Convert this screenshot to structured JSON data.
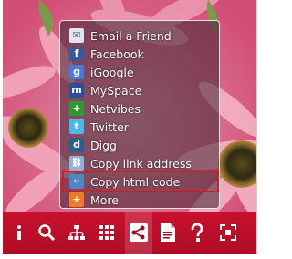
{
  "share_menu": {
    "items": [
      {
        "label": "Email a Friend",
        "icon": "email-icon",
        "icon_color": "#dfe6ee"
      },
      {
        "label": "Facebook",
        "icon": "facebook-icon",
        "icon_color": "#3b5998"
      },
      {
        "label": "iGoogle",
        "icon": "igoogle-icon",
        "icon_color": "#4a7bd9"
      },
      {
        "label": "MySpace",
        "icon": "myspace-icon",
        "icon_color": "#2b4f9b"
      },
      {
        "label": "Netvibes",
        "icon": "netvibes-icon",
        "icon_color": "#2f9a33"
      },
      {
        "label": "Twitter",
        "icon": "twitter-icon",
        "icon_color": "#4fb7e8"
      },
      {
        "label": "Digg",
        "icon": "digg-icon",
        "icon_color": "#2f5f8f"
      },
      {
        "label": "Copy link address",
        "icon": "link-icon",
        "icon_color": "#8fb3d9"
      },
      {
        "label": "Copy html code",
        "icon": "code-icon",
        "icon_color": "#4f86c6"
      },
      {
        "label": "More",
        "icon": "more-icon",
        "icon_color": "#f07a2a"
      }
    ],
    "highlighted_item": "Copy html code",
    "highlight_color": "#e0141c"
  },
  "toolbar": {
    "background_color": "#b00d25",
    "buttons": [
      {
        "icon": "info-icon"
      },
      {
        "icon": "search-icon"
      },
      {
        "icon": "sitemap-icon"
      },
      {
        "icon": "grid-icon"
      },
      {
        "icon": "share-icon",
        "active": true
      },
      {
        "icon": "document-icon"
      },
      {
        "icon": "help-icon"
      },
      {
        "icon": "fullscreen-icon"
      }
    ]
  }
}
